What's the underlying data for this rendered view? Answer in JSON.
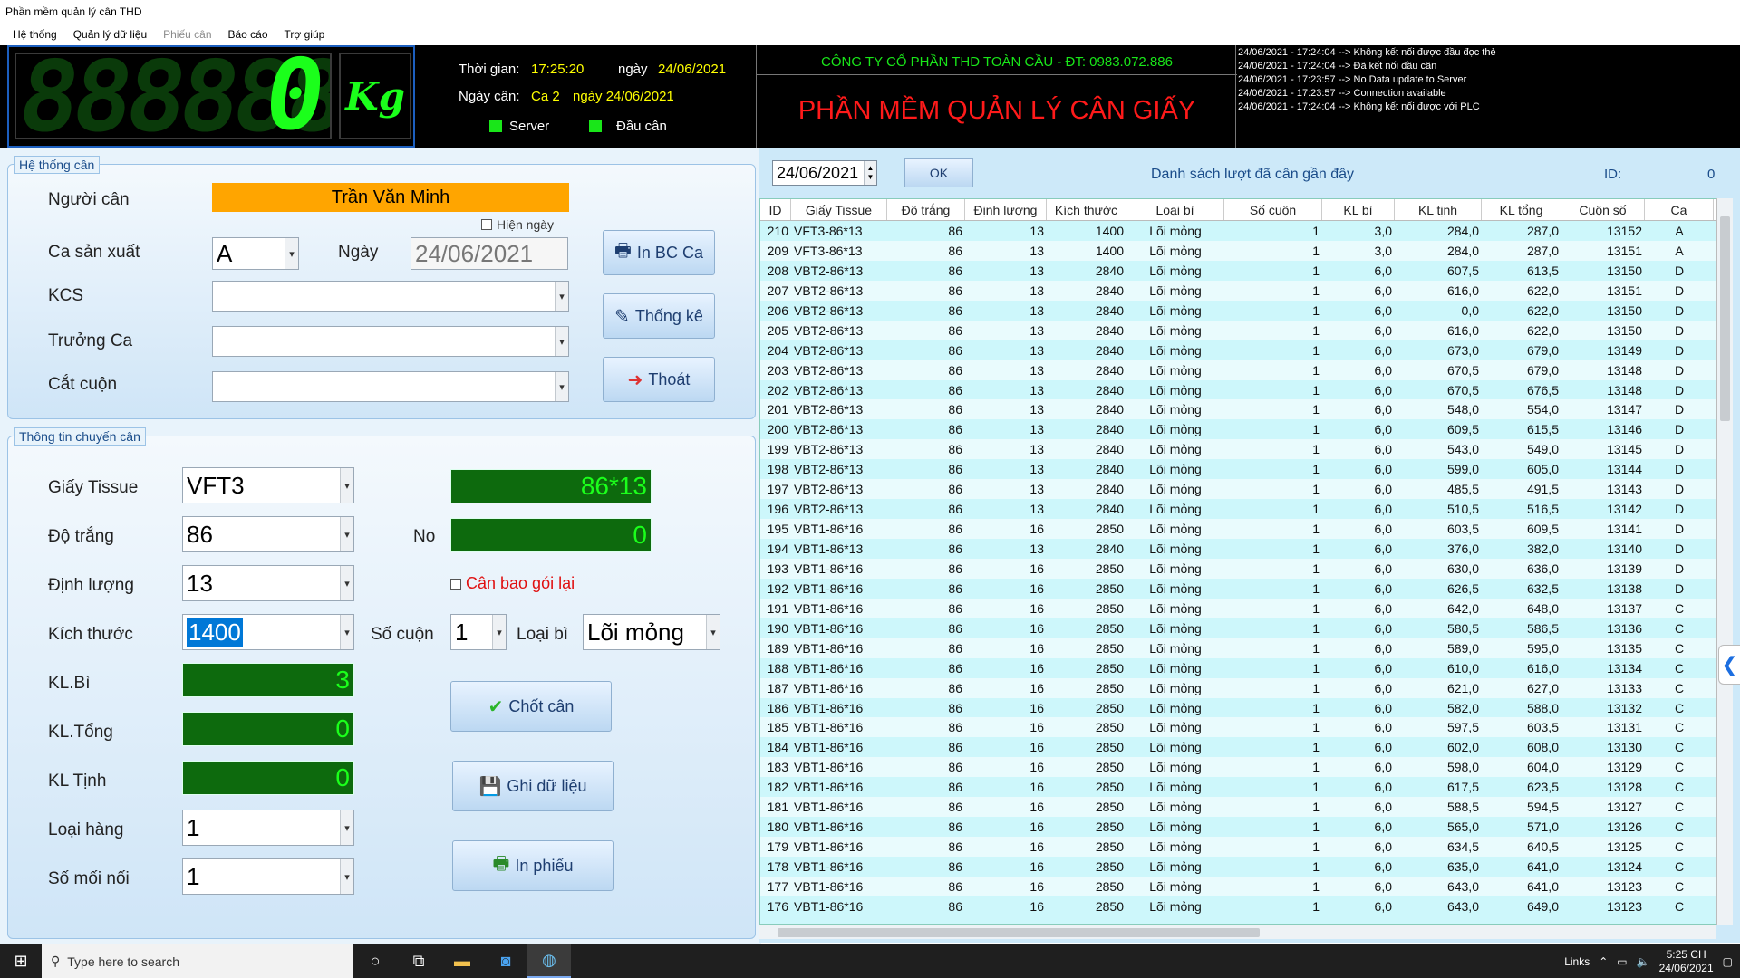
{
  "window": {
    "title": "Phần mềm quản lý cân THD"
  },
  "menu": [
    "Hệ thống",
    "Quản lý dữ liệu",
    "Phiếu cân",
    "Báo cáo",
    "Trợ giúp"
  ],
  "scale": {
    "ghost": "888888",
    "value": "0",
    "unit": "Kg"
  },
  "time_panel": {
    "time_label": "Thời gian:",
    "time_value": "17:25:20",
    "day_label": "ngày",
    "day_value": "24/06/2021",
    "weigh_label": "Ngày cân:",
    "shift_value": "Ca 2",
    "weigh_day_value": "ngày 24/06/2021",
    "server_label": "Server",
    "head_label": "Đầu cân",
    "indicator_color": "#19e619"
  },
  "company": {
    "name": "CÔNG TY CỔ PHẦN THD TOÀN CẦU - ĐT: 0983.072.886",
    "app_name": "PHẦN MỀM QUẢN LÝ CÂN GIẤY"
  },
  "log": [
    "24/06/2021 - 17:24:04 --> Không kết nối được đầu đọc thẻ",
    "24/06/2021 - 17:24:04 --> Đã kết nối đầu cân",
    "24/06/2021 - 17:23:57 --> No Data update to Server",
    "24/06/2021 - 17:23:57 --> Connection available",
    "24/06/2021 - 17:24:04 --> Không kết nối được với PLC"
  ],
  "system_group": {
    "title": "Hệ thống cân",
    "weigher_label": "Người cân",
    "weigher_value": "Trần Văn Minh",
    "show_day_label": "Hiện ngày",
    "shift_label": "Ca sản xuất",
    "shift_value": "A",
    "date_label": "Ngày",
    "date_value": "24/06/2021",
    "kcs_label": "KCS",
    "kcs_value": "",
    "leader_label": "Trưởng Ca",
    "leader_value": "",
    "cutter_label": "Cắt cuộn",
    "cutter_value": "",
    "print_shift_btn": "In BC Ca",
    "stats_btn": "Thống kê",
    "exit_btn": "Thoát"
  },
  "transfer_group": {
    "title": "Thông tin chuyến cân",
    "paper_label": "Giấy Tissue",
    "paper_value": "VFT3",
    "brightness_label": "Độ trắng",
    "brightness_value": "86",
    "gsm_label": "Định lượng",
    "gsm_value": "13",
    "size_label": "Kích thước",
    "size_value": "1400",
    "tare_label": "KL.Bì",
    "tare_value": "3",
    "gross_label": "KL.Tổng",
    "gross_value": "0",
    "net_label": "KL Tịnh",
    "net_value": "0",
    "goods_label": "Loại hàng",
    "goods_value": "1",
    "joints_label": "Số mối nối",
    "joints_value": "1",
    "code_value": "86*13",
    "no_label": "No",
    "no_value": "0",
    "repack_label": "Cân bao gói lại",
    "rolls_label": "Số cuộn",
    "rolls_value": "1",
    "tare_type_label": "Loại bì",
    "tare_type_value": "Lõi mỏng",
    "confirm_btn": "Chốt cân",
    "save_btn": "Ghi dữ liệu",
    "print_btn": "In phiếu"
  },
  "list_panel": {
    "date_value": "24/06/2021",
    "ok_label": "OK",
    "title": "Danh sách lượt đã cân gần đây",
    "id_label": "ID:",
    "id_value": "0",
    "columns": [
      "ID",
      "Giấy Tissue",
      "Độ trắng",
      "Định lượng",
      "Kích thước",
      "Loại bì",
      "Số cuộn",
      "KL bì",
      "KL tịnh",
      "KL tổng",
      "Cuộn số",
      "Ca"
    ],
    "rows": [
      [
        "210",
        "VFT3-86*13",
        "86",
        "13",
        "1400",
        "Lõi mỏng",
        "1",
        "3,0",
        "284,0",
        "287,0",
        "13152",
        "A"
      ],
      [
        "209",
        "VFT3-86*13",
        "86",
        "13",
        "1400",
        "Lõi mỏng",
        "1",
        "3,0",
        "284,0",
        "287,0",
        "13151",
        "A"
      ],
      [
        "208",
        "VBT2-86*13",
        "86",
        "13",
        "2840",
        "Lõi mỏng",
        "1",
        "6,0",
        "607,5",
        "613,5",
        "13150",
        "D"
      ],
      [
        "207",
        "VBT2-86*13",
        "86",
        "13",
        "2840",
        "Lõi mỏng",
        "1",
        "6,0",
        "616,0",
        "622,0",
        "13151",
        "D"
      ],
      [
        "206",
        "VBT2-86*13",
        "86",
        "13",
        "2840",
        "Lõi mỏng",
        "1",
        "6,0",
        "0,0",
        "622,0",
        "13150",
        "D"
      ],
      [
        "205",
        "VBT2-86*13",
        "86",
        "13",
        "2840",
        "Lõi mỏng",
        "1",
        "6,0",
        "616,0",
        "622,0",
        "13150",
        "D"
      ],
      [
        "204",
        "VBT2-86*13",
        "86",
        "13",
        "2840",
        "Lõi mỏng",
        "1",
        "6,0",
        "673,0",
        "679,0",
        "13149",
        "D"
      ],
      [
        "203",
        "VBT2-86*13",
        "86",
        "13",
        "2840",
        "Lõi mỏng",
        "1",
        "6,0",
        "670,5",
        "679,0",
        "13148",
        "D"
      ],
      [
        "202",
        "VBT2-86*13",
        "86",
        "13",
        "2840",
        "Lõi mỏng",
        "1",
        "6,0",
        "670,5",
        "676,5",
        "13148",
        "D"
      ],
      [
        "201",
        "VBT2-86*13",
        "86",
        "13",
        "2840",
        "Lõi mỏng",
        "1",
        "6,0",
        "548,0",
        "554,0",
        "13147",
        "D"
      ],
      [
        "200",
        "VBT2-86*13",
        "86",
        "13",
        "2840",
        "Lõi mỏng",
        "1",
        "6,0",
        "609,5",
        "615,5",
        "13146",
        "D"
      ],
      [
        "199",
        "VBT2-86*13",
        "86",
        "13",
        "2840",
        "Lõi mỏng",
        "1",
        "6,0",
        "543,0",
        "549,0",
        "13145",
        "D"
      ],
      [
        "198",
        "VBT2-86*13",
        "86",
        "13",
        "2840",
        "Lõi mỏng",
        "1",
        "6,0",
        "599,0",
        "605,0",
        "13144",
        "D"
      ],
      [
        "197",
        "VBT2-86*13",
        "86",
        "13",
        "2840",
        "Lõi mỏng",
        "1",
        "6,0",
        "485,5",
        "491,5",
        "13143",
        "D"
      ],
      [
        "196",
        "VBT2-86*13",
        "86",
        "13",
        "2840",
        "Lõi mỏng",
        "1",
        "6,0",
        "510,5",
        "516,5",
        "13142",
        "D"
      ],
      [
        "195",
        "VBT1-86*16",
        "86",
        "16",
        "2850",
        "Lõi mỏng",
        "1",
        "6,0",
        "603,5",
        "609,5",
        "13141",
        "D"
      ],
      [
        "194",
        "VBT1-86*13",
        "86",
        "13",
        "2840",
        "Lõi mỏng",
        "1",
        "6,0",
        "376,0",
        "382,0",
        "13140",
        "D"
      ],
      [
        "193",
        "VBT1-86*16",
        "86",
        "16",
        "2850",
        "Lõi mỏng",
        "1",
        "6,0",
        "630,0",
        "636,0",
        "13139",
        "D"
      ],
      [
        "192",
        "VBT1-86*16",
        "86",
        "16",
        "2850",
        "Lõi mỏng",
        "1",
        "6,0",
        "626,5",
        "632,5",
        "13138",
        "D"
      ],
      [
        "191",
        "VBT1-86*16",
        "86",
        "16",
        "2850",
        "Lõi mỏng",
        "1",
        "6,0",
        "642,0",
        "648,0",
        "13137",
        "C"
      ],
      [
        "190",
        "VBT1-86*16",
        "86",
        "16",
        "2850",
        "Lõi mỏng",
        "1",
        "6,0",
        "580,5",
        "586,5",
        "13136",
        "C"
      ],
      [
        "189",
        "VBT1-86*16",
        "86",
        "16",
        "2850",
        "Lõi mỏng",
        "1",
        "6,0",
        "589,0",
        "595,0",
        "13135",
        "C"
      ],
      [
        "188",
        "VBT1-86*16",
        "86",
        "16",
        "2850",
        "Lõi mỏng",
        "1",
        "6,0",
        "610,0",
        "616,0",
        "13134",
        "C"
      ],
      [
        "187",
        "VBT1-86*16",
        "86",
        "16",
        "2850",
        "Lõi mỏng",
        "1",
        "6,0",
        "621,0",
        "627,0",
        "13133",
        "C"
      ],
      [
        "186",
        "VBT1-86*16",
        "86",
        "16",
        "2850",
        "Lõi mỏng",
        "1",
        "6,0",
        "582,0",
        "588,0",
        "13132",
        "C"
      ],
      [
        "185",
        "VBT1-86*16",
        "86",
        "16",
        "2850",
        "Lõi mỏng",
        "1",
        "6,0",
        "597,5",
        "603,5",
        "13131",
        "C"
      ],
      [
        "184",
        "VBT1-86*16",
        "86",
        "16",
        "2850",
        "Lõi mỏng",
        "1",
        "6,0",
        "602,0",
        "608,0",
        "13130",
        "C"
      ],
      [
        "183",
        "VBT1-86*16",
        "86",
        "16",
        "2850",
        "Lõi mỏng",
        "1",
        "6,0",
        "598,0",
        "604,0",
        "13129",
        "C"
      ],
      [
        "182",
        "VBT1-86*16",
        "86",
        "16",
        "2850",
        "Lõi mỏng",
        "1",
        "6,0",
        "617,5",
        "623,5",
        "13128",
        "C"
      ],
      [
        "181",
        "VBT1-86*16",
        "86",
        "16",
        "2850",
        "Lõi mỏng",
        "1",
        "6,0",
        "588,5",
        "594,5",
        "13127",
        "C"
      ],
      [
        "180",
        "VBT1-86*16",
        "86",
        "16",
        "2850",
        "Lõi mỏng",
        "1",
        "6,0",
        "565,0",
        "571,0",
        "13126",
        "C"
      ],
      [
        "179",
        "VBT1-86*16",
        "86",
        "16",
        "2850",
        "Lõi mỏng",
        "1",
        "6,0",
        "634,5",
        "640,5",
        "13125",
        "C"
      ],
      [
        "178",
        "VBT1-86*16",
        "86",
        "16",
        "2850",
        "Lõi mỏng",
        "1",
        "6,0",
        "635,0",
        "641,0",
        "13124",
        "C"
      ],
      [
        "177",
        "VBT1-86*16",
        "86",
        "16",
        "2850",
        "Lõi mỏng",
        "1",
        "6,0",
        "643,0",
        "641,0",
        "13123",
        "C"
      ],
      [
        "176",
        "VBT1-86*16",
        "86",
        "16",
        "2850",
        "Lõi mỏng",
        "1",
        "6,0",
        "643,0",
        "649,0",
        "13123",
        "C"
      ]
    ]
  },
  "taskbar": {
    "search_placeholder": "Type here to search",
    "links_label": "Links",
    "time": "5:25 CH",
    "date": "24/06/2021"
  }
}
